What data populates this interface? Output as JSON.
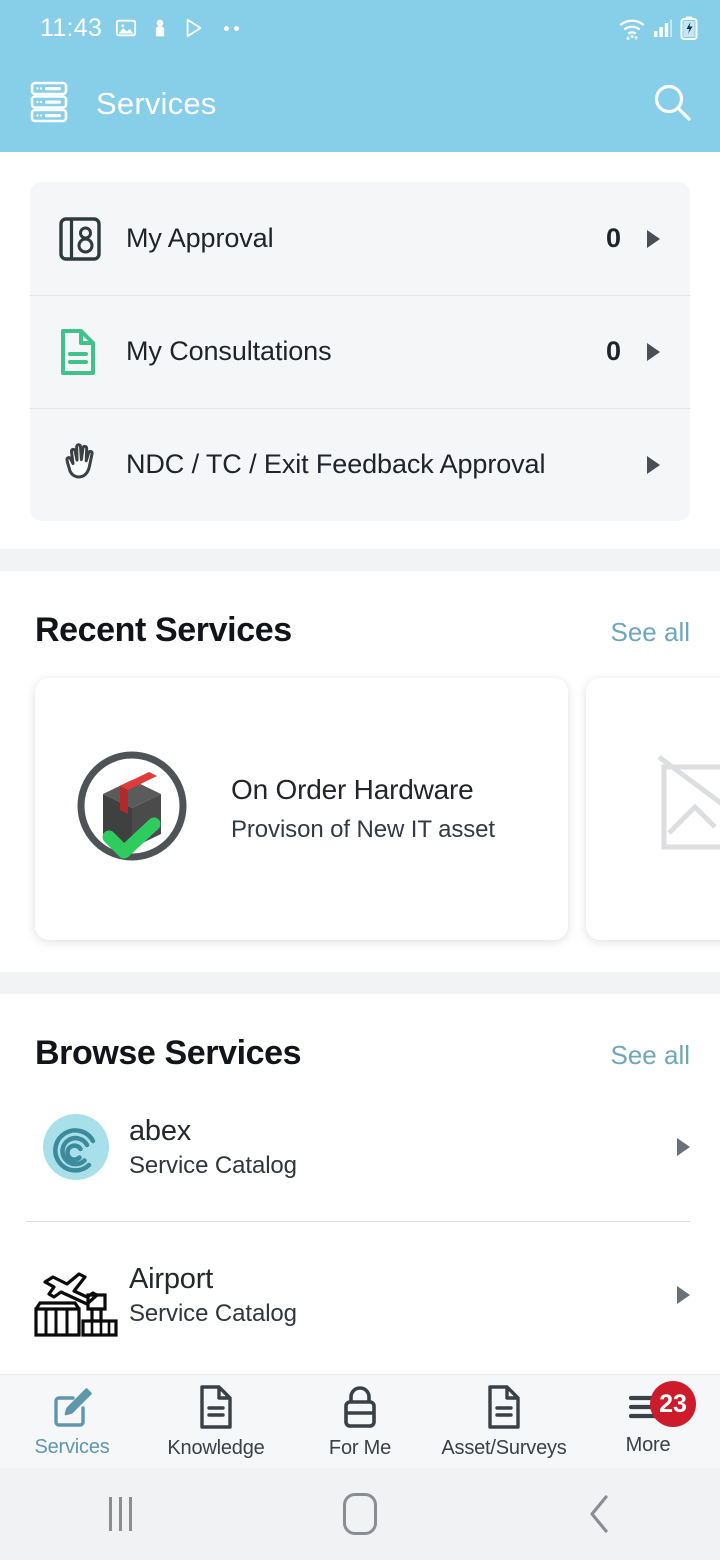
{
  "status_bar": {
    "time": "11:43",
    "left_icons": [
      "image-icon",
      "person-pin-icon",
      "play-store-icon",
      "more-dots-icon"
    ],
    "right_icons": [
      "wifi-icon",
      "cellular-signal-icon",
      "battery-charging-icon"
    ]
  },
  "app_bar": {
    "menu_icon": "server-stack-icon",
    "title": "Services",
    "search_icon": "search-icon"
  },
  "quick_links": {
    "items": [
      {
        "icon": "contact-book-icon",
        "label": "My Approval",
        "count": "0",
        "has_count": true
      },
      {
        "icon": "document-icon",
        "label": "My Consultations",
        "count": "0",
        "has_count": true
      },
      {
        "icon": "hand-icon",
        "label": "NDC / TC / Exit Feedback Approval",
        "count": "",
        "has_count": false
      }
    ]
  },
  "recent_services": {
    "title": "Recent Services",
    "see_all": "See all",
    "cards": [
      {
        "icon": "package-box-approved-icon",
        "title": "On Order Hardware",
        "subtitle": "Provison of New IT asset"
      },
      {
        "icon": "broken-image-placeholder-icon",
        "title": "",
        "subtitle": ""
      }
    ]
  },
  "browse_services": {
    "title": "Browse Services",
    "see_all": "See all",
    "items": [
      {
        "icon": "abex-swirl-icon",
        "title": "abex",
        "subtitle": "Service Catalog"
      },
      {
        "icon": "airport-terminal-icon",
        "title": "Airport",
        "subtitle": "Service Catalog"
      }
    ]
  },
  "bottom_nav": {
    "items": [
      {
        "icon": "pencil-square-icon",
        "label": "Services",
        "active": true,
        "badge": ""
      },
      {
        "icon": "document-icon",
        "label": "Knowledge",
        "active": false,
        "badge": ""
      },
      {
        "icon": "lock-icon",
        "label": "For Me",
        "active": false,
        "badge": ""
      },
      {
        "icon": "document-icon",
        "label": "Asset/Surveys",
        "active": false,
        "badge": ""
      },
      {
        "icon": "hamburger-menu-icon",
        "label": "More",
        "active": false,
        "badge": "23"
      }
    ]
  },
  "system_nav": {
    "recents_icon": "recents-icon",
    "home_icon": "home-icon",
    "back_icon": "back-icon"
  },
  "colors": {
    "header_blue": "#87CEE8",
    "accent_teal": "#6FA6BC",
    "badge_red": "#CC1C2C",
    "green": "#3FC38A",
    "card_gray": "#F5F6F7"
  }
}
